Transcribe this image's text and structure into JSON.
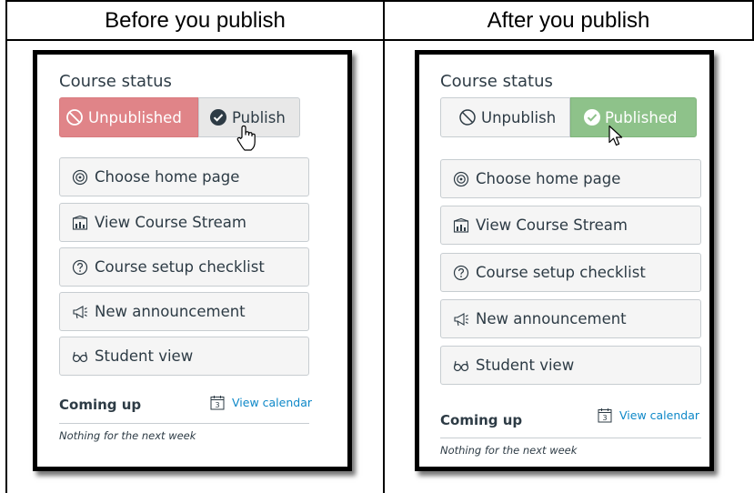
{
  "columns": [
    {
      "header": "Before you publish",
      "panel": {
        "title": "Course status",
        "status_buttons": [
          {
            "label": "Unpublished",
            "icon": "ban-icon",
            "state": "active-red"
          },
          {
            "label": "Publish",
            "icon": "check-circle-icon",
            "state": "hover"
          }
        ],
        "actions": [
          {
            "label": "Choose home page",
            "icon": "target-icon"
          },
          {
            "label": "View Course Stream",
            "icon": "stream-icon"
          },
          {
            "label": "Course setup checklist",
            "icon": "question-circle-icon"
          },
          {
            "label": "New announcement",
            "icon": "megaphone-icon"
          },
          {
            "label": "Student view",
            "icon": "glasses-icon"
          }
        ],
        "coming_up": "Coming up",
        "view_calendar": "View calendar",
        "calendar_day": "3",
        "empty_note": "Nothing for the next week"
      },
      "cursor": "hand-pointer"
    },
    {
      "header": "After you publish",
      "panel": {
        "title": "Course status",
        "status_buttons": [
          {
            "label": "Unpublish",
            "icon": "ban-icon",
            "state": "neutral"
          },
          {
            "label": "Published",
            "icon": "check-circle-icon",
            "state": "active-green"
          }
        ],
        "actions": [
          {
            "label": "Choose home page",
            "icon": "target-icon"
          },
          {
            "label": "View Course Stream",
            "icon": "stream-icon"
          },
          {
            "label": "Course setup checklist",
            "icon": "question-circle-icon"
          },
          {
            "label": "New announcement",
            "icon": "megaphone-icon"
          },
          {
            "label": "Student view",
            "icon": "glasses-icon"
          }
        ],
        "coming_up": "Coming up",
        "view_calendar": "View calendar",
        "calendar_day": "3",
        "empty_note": "Nothing for the next week"
      },
      "cursor": "arrow-pointer"
    }
  ],
  "colors": {
    "unpublished_red": "#e08488",
    "published_green": "#8ec28a",
    "link_blue": "#0e88c8",
    "text_dark": "#2d3b45"
  }
}
